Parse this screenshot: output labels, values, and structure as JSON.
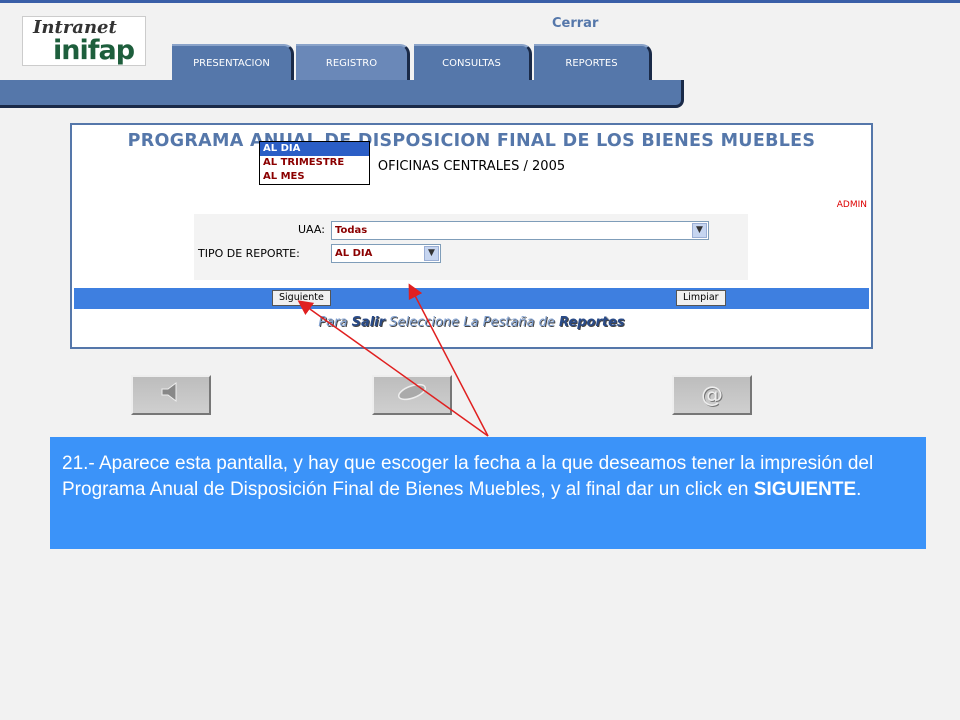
{
  "app": {
    "logo_top": "Intranet",
    "logo_bottom": "inifap",
    "close_link": "Cerrar"
  },
  "tabs": [
    {
      "label": "PRESENTACION"
    },
    {
      "label": "REGISTRO"
    },
    {
      "label": "CONSULTAS"
    },
    {
      "label": "REPORTES"
    }
  ],
  "panel": {
    "title": "PROGRAMA ANUAL DE DISPOSICION FINAL DE LOS BIENES MUEBLES",
    "subtitle": "OFICINAS CENTRALES / 2005",
    "user": "ADMIN"
  },
  "form": {
    "uaa_label": "UAA:",
    "uaa_value": "Todas",
    "report_type_label": "TIPO DE REPORTE:",
    "report_type_value": "AL DIA",
    "report_type_options": [
      "AL DIA",
      "AL TRIMESTRE",
      "AL MES"
    ]
  },
  "buttons": {
    "next": "Siguiente",
    "clear": "Limpiar"
  },
  "hint": {
    "prefix": "Para",
    "salir": "Salir",
    "middle": "Seleccione La Pestaña de",
    "reportes": "Reportes"
  },
  "nav": {
    "back_icon": "speaker-left-icon",
    "home_icon": "leaf-icon",
    "mail_icon": "at-icon"
  },
  "callout": {
    "text_before": "21.- Aparece esta pantalla, y hay que escoger la fecha a la que deseamos tener la impresión del Programa Anual de Disposición Final de Bienes Muebles, y al final dar un click en",
    "text_bold": "SIGUIENTE",
    "text_after": "."
  },
  "colors": {
    "accent": "#5577aa",
    "callout_bg": "#3b93f9",
    "button_bar": "#3e7fe0",
    "arrow": "#e02020"
  }
}
